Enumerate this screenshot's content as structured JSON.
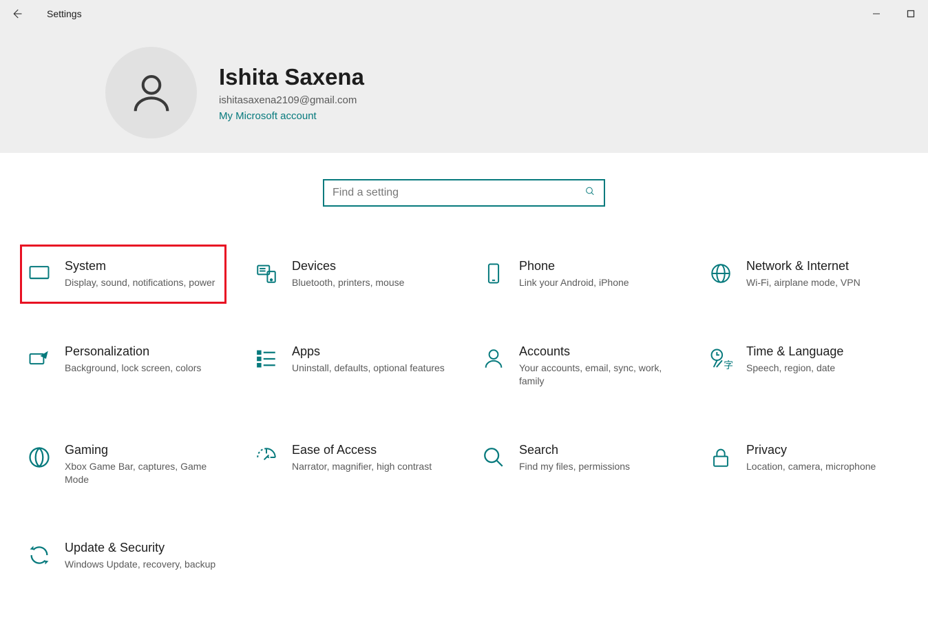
{
  "window": {
    "title": "Settings"
  },
  "profile": {
    "name": "Ishita Saxena",
    "email": "ishitasaxena2109@gmail.com",
    "link": "My Microsoft account"
  },
  "search": {
    "placeholder": "Find a setting"
  },
  "categories": [
    {
      "id": "system",
      "title": "System",
      "desc": "Display, sound, notifications, power",
      "highlight": true,
      "icon": "monitor"
    },
    {
      "id": "devices",
      "title": "Devices",
      "desc": "Bluetooth, printers, mouse",
      "icon": "devices"
    },
    {
      "id": "phone",
      "title": "Phone",
      "desc": "Link your Android, iPhone",
      "icon": "phone"
    },
    {
      "id": "network",
      "title": "Network & Internet",
      "desc": "Wi-Fi, airplane mode, VPN",
      "icon": "globe"
    },
    {
      "id": "personalization",
      "title": "Personalization",
      "desc": "Background, lock screen, colors",
      "icon": "brush"
    },
    {
      "id": "apps",
      "title": "Apps",
      "desc": "Uninstall, defaults, optional features",
      "icon": "apps"
    },
    {
      "id": "accounts",
      "title": "Accounts",
      "desc": "Your accounts, email, sync, work, family",
      "icon": "person"
    },
    {
      "id": "time",
      "title": "Time & Language",
      "desc": "Speech, region, date",
      "icon": "time"
    },
    {
      "id": "gaming",
      "title": "Gaming",
      "desc": "Xbox Game Bar, captures, Game Mode",
      "icon": "gaming"
    },
    {
      "id": "ease",
      "title": "Ease of Access",
      "desc": "Narrator, magnifier, high contrast",
      "icon": "ease"
    },
    {
      "id": "search",
      "title": "Search",
      "desc": "Find my files, permissions",
      "icon": "search"
    },
    {
      "id": "privacy",
      "title": "Privacy",
      "desc": "Location, camera, microphone",
      "icon": "lock"
    },
    {
      "id": "update",
      "title": "Update & Security",
      "desc": "Windows Update, recovery, backup",
      "icon": "sync"
    }
  ],
  "colors": {
    "accent": "#077a7d",
    "highlight_border": "#e81123"
  }
}
